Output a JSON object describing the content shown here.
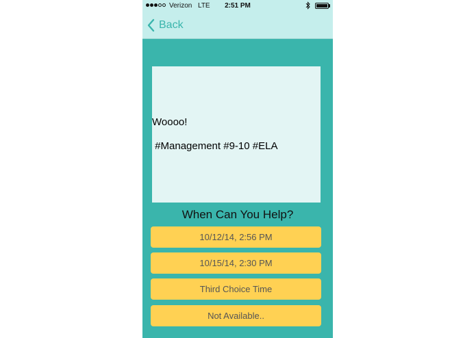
{
  "status_bar": {
    "carrier": "Verizon",
    "network": "LTE",
    "time": "2:51 PM"
  },
  "nav": {
    "back_label": "Back"
  },
  "post": {
    "line1": "Woooo!",
    "line2": " #Management #9-10 #ELA"
  },
  "section_title": "When Can You Help?",
  "choices": [
    {
      "label": "10/12/14, 2:56 PM"
    },
    {
      "label": "10/15/14, 2:30 PM"
    },
    {
      "label": "Third Choice Time"
    },
    {
      "label": "Not Available.."
    }
  ],
  "colors": {
    "background": "#3ab5ac",
    "bar": "#c5eeec",
    "card": "#e3f5f4",
    "button": "#ffd153"
  }
}
